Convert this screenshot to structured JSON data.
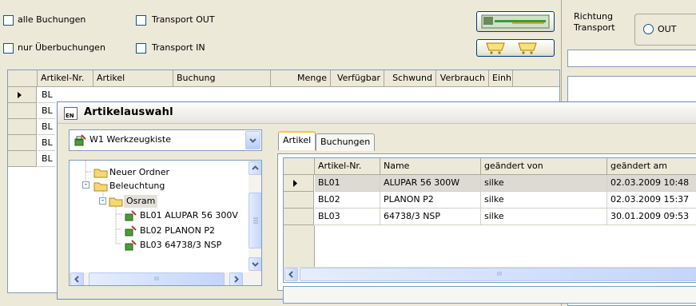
{
  "filters": {
    "alle_buchungen": "alle Buchungen",
    "nur_ueberbuchungen": "nur Überbuchungen",
    "transport_out": "Transport OUT",
    "transport_in": "Transport IN"
  },
  "richtung": {
    "label_line1": "Richtung",
    "label_line2": "Transport",
    "option_out": "OUT"
  },
  "main_grid": {
    "columns": [
      "Artikel-Nr.",
      "Artikel",
      "Buchung",
      "Menge",
      "Verfügbar",
      "Schwund",
      "Verbrauch",
      "Einh"
    ],
    "rows": [
      "BL",
      "BL",
      "BL",
      "BL",
      "BL"
    ]
  },
  "dialog": {
    "logo": "EN",
    "title": "Artikelauswahl",
    "kit_combo_value": "W1 Werkzeugkiste",
    "tree": {
      "items": [
        "Neuer Ordner",
        "Beleuchtung",
        "Osram",
        "BL01 ALUPAR 56 300V",
        "BL02 PLANON P2",
        "BL03 64738/3 NSP"
      ]
    },
    "tabs": [
      "Artikel",
      "Buchungen"
    ],
    "grid": {
      "columns": [
        "Artikel-Nr.",
        "Name",
        "geändert von",
        "geändert am"
      ],
      "rows": [
        [
          "BL01",
          "ALUPAR 56 300W",
          "silke",
          "02.03.2009 10:48"
        ],
        [
          "BL02",
          "PLANON P2",
          "silke",
          "02.03.2009 15:37"
        ],
        [
          "BL03",
          "64738/3 NSP",
          "silke",
          "30.01.2009 09:53"
        ]
      ],
      "scroll_mark": "III"
    },
    "tree_scroll_mark": "III"
  },
  "colors": {
    "window_bg": "#ece9d8",
    "border_blue": "#7f9db9",
    "tab_accent": "#ffc83c",
    "selected_row": "#dcdad3"
  }
}
